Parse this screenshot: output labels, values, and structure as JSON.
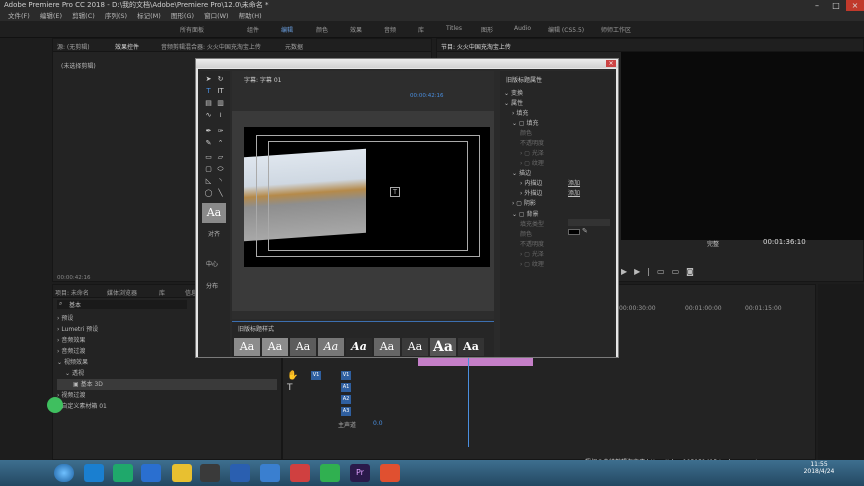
{
  "app": {
    "title": "Adobe Premiere Pro CC 2018 - D:\\我的文档\\Adobe\\Premiere Pro\\12.0\\未命名 *"
  },
  "menu": [
    "文件(F)",
    "编辑(E)",
    "剪辑(C)",
    "序列(S)",
    "标记(M)",
    "图形(G)",
    "窗口(W)",
    "帮助(H)"
  ],
  "workspaces": [
    "所有面板",
    "组件",
    "编辑",
    "颜色",
    "效果",
    "音频",
    "库",
    "Titles",
    "图形",
    "Audio",
    "编辑 (CS5.5)",
    "师师工作区"
  ],
  "source_panel": {
    "tabs": [
      "源: (无剪辑)",
      "效果控件",
      "音频剪辑混合器: 火火中国充淘宝上传",
      "元数据"
    ],
    "content": "(未选择剪辑)",
    "timecode": "00:00:42:16"
  },
  "program_panel": {
    "title": "节目: 火火中国充淘宝上传",
    "quality": "完整",
    "timecode": "00:01:36:10"
  },
  "project_panel": {
    "tabs": [
      "项目: 未命名",
      "媒体浏览器",
      "库",
      "信息"
    ],
    "search": "基本",
    "tree": [
      "预设",
      "Lumetri 预设",
      "音频效果",
      "音频过渡",
      "视频效果",
      "透视",
      "基本 3D",
      "视频过渡",
      "自定义素材箱 01"
    ]
  },
  "title_dialog": {
    "tab_title": "字幕: 字幕 01",
    "timecode": "00:00:42:16",
    "tools_sections": [
      "对齐",
      "中心",
      "分布"
    ],
    "styles_title": "旧版标题样式",
    "style_samples": [
      "Aa",
      "Aa",
      "Aa",
      "Aa",
      "Aa",
      "Aa",
      "Aa",
      "Aa",
      "Aa"
    ],
    "props_title": "旧版标题属性",
    "props": [
      {
        "label": "变换",
        "dim": false
      },
      {
        "label": "属性",
        "dim": false
      },
      {
        "label": "填充",
        "dim": false
      },
      {
        "label": "填充",
        "dim": false
      },
      {
        "label": "颜色",
        "dim": true
      },
      {
        "label": "不透明度",
        "dim": true
      },
      {
        "label": "光泽",
        "dim": true
      },
      {
        "label": "纹理",
        "dim": true
      },
      {
        "label": "描边",
        "dim": false
      },
      {
        "label": "内描边",
        "dim": false,
        "action": "添加"
      },
      {
        "label": "外描边",
        "dim": false,
        "action": "添加"
      },
      {
        "label": "阴影",
        "dim": false
      },
      {
        "label": "背景",
        "dim": false
      },
      {
        "label": "填充类型",
        "dim": true
      },
      {
        "label": "颜色",
        "dim": true
      },
      {
        "label": "不透明度",
        "dim": true
      },
      {
        "label": "光泽",
        "dim": true
      },
      {
        "label": "纹理",
        "dim": true
      }
    ]
  },
  "timeline": {
    "ruler": [
      "00:00:00",
      "00:00:15:00",
      "00:00:30:00",
      "00:00:45:00",
      "00:01:00:00",
      "00:01:15:00",
      "00:01:30:00"
    ],
    "video_tracks": [
      "V3",
      "V2",
      "V1"
    ],
    "audio_tracks": [
      "A1",
      "A2",
      "A3"
    ],
    "master": "主声道",
    "master_value": "0.0"
  },
  "taskbar": {
    "time": "11:55",
    "date": "2018/4/24"
  },
  "watermark": "授权@袁帅剪辑淘宝店 https://shop105951415.taobao.com/",
  "colors": {
    "accent": "#4a8fe0",
    "clip": "#c57fc8"
  }
}
